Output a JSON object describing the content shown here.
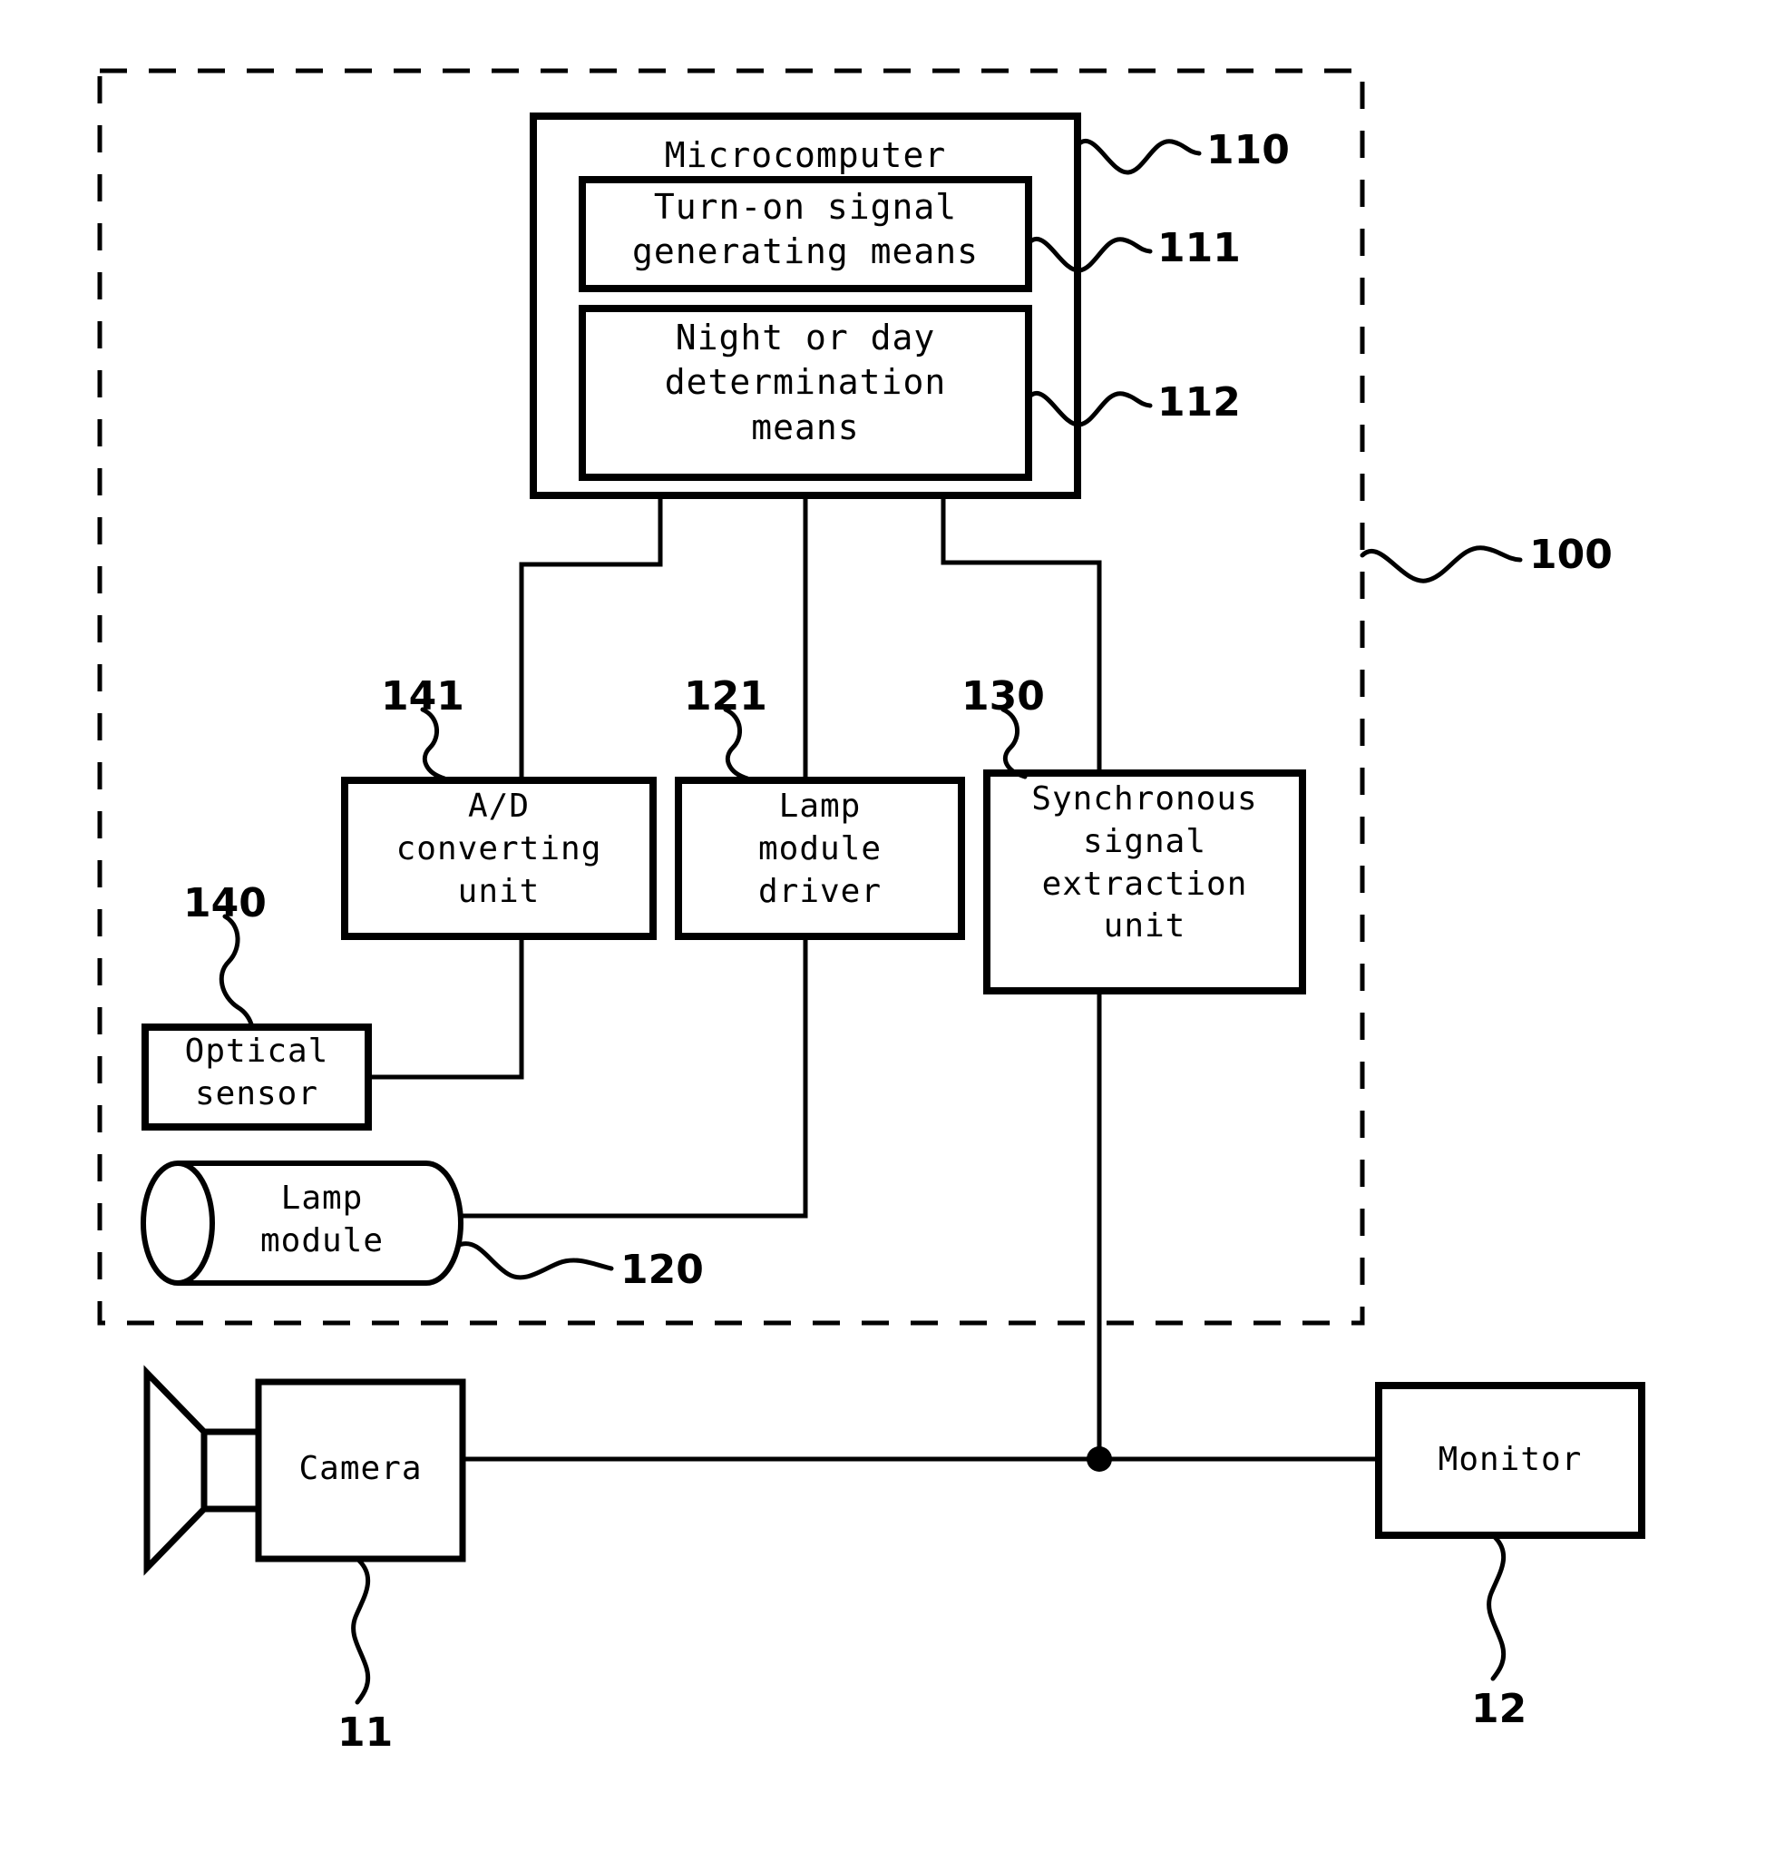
{
  "figure": {
    "type": "patent-block-diagram",
    "system_boundary_ref": "100"
  },
  "blocks": {
    "microcomputer": {
      "label": "Microcomputer",
      "ref": "110"
    },
    "turn_on_signal": {
      "label": "Turn-on signal\ngenerating means",
      "ref": "111"
    },
    "night_day": {
      "label": "Night or day\ndetermination\nmeans",
      "ref": "112"
    },
    "ad_converting": {
      "label": "A/D\nconverting\nunit",
      "ref": "141"
    },
    "lamp_driver": {
      "label": "Lamp\nmodule\ndriver",
      "ref": "121"
    },
    "sync_extraction": {
      "label": "Synchronous\nsignal\nextraction\nunit",
      "ref": "130"
    },
    "optical_sensor": {
      "label": "Optical\nsensor",
      "ref": "140"
    },
    "lamp_module": {
      "label": "Lamp\nmodule",
      "ref": "120"
    },
    "camera": {
      "label": "Camera",
      "ref": "11"
    },
    "monitor": {
      "label": "Monitor",
      "ref": "12"
    }
  },
  "reference_numerals": {
    "system": "100",
    "microcomputer": "110",
    "turn_on_signal_generating_means": "111",
    "night_or_day_determination_means": "112",
    "lamp_module": "120",
    "lamp_module_driver": "121",
    "synchronous_signal_extraction_unit": "130",
    "optical_sensor": "140",
    "ad_converting_unit": "141",
    "camera": "11",
    "monitor": "12"
  },
  "colors": {
    "ink": "#000000",
    "paper": "#ffffff"
  }
}
